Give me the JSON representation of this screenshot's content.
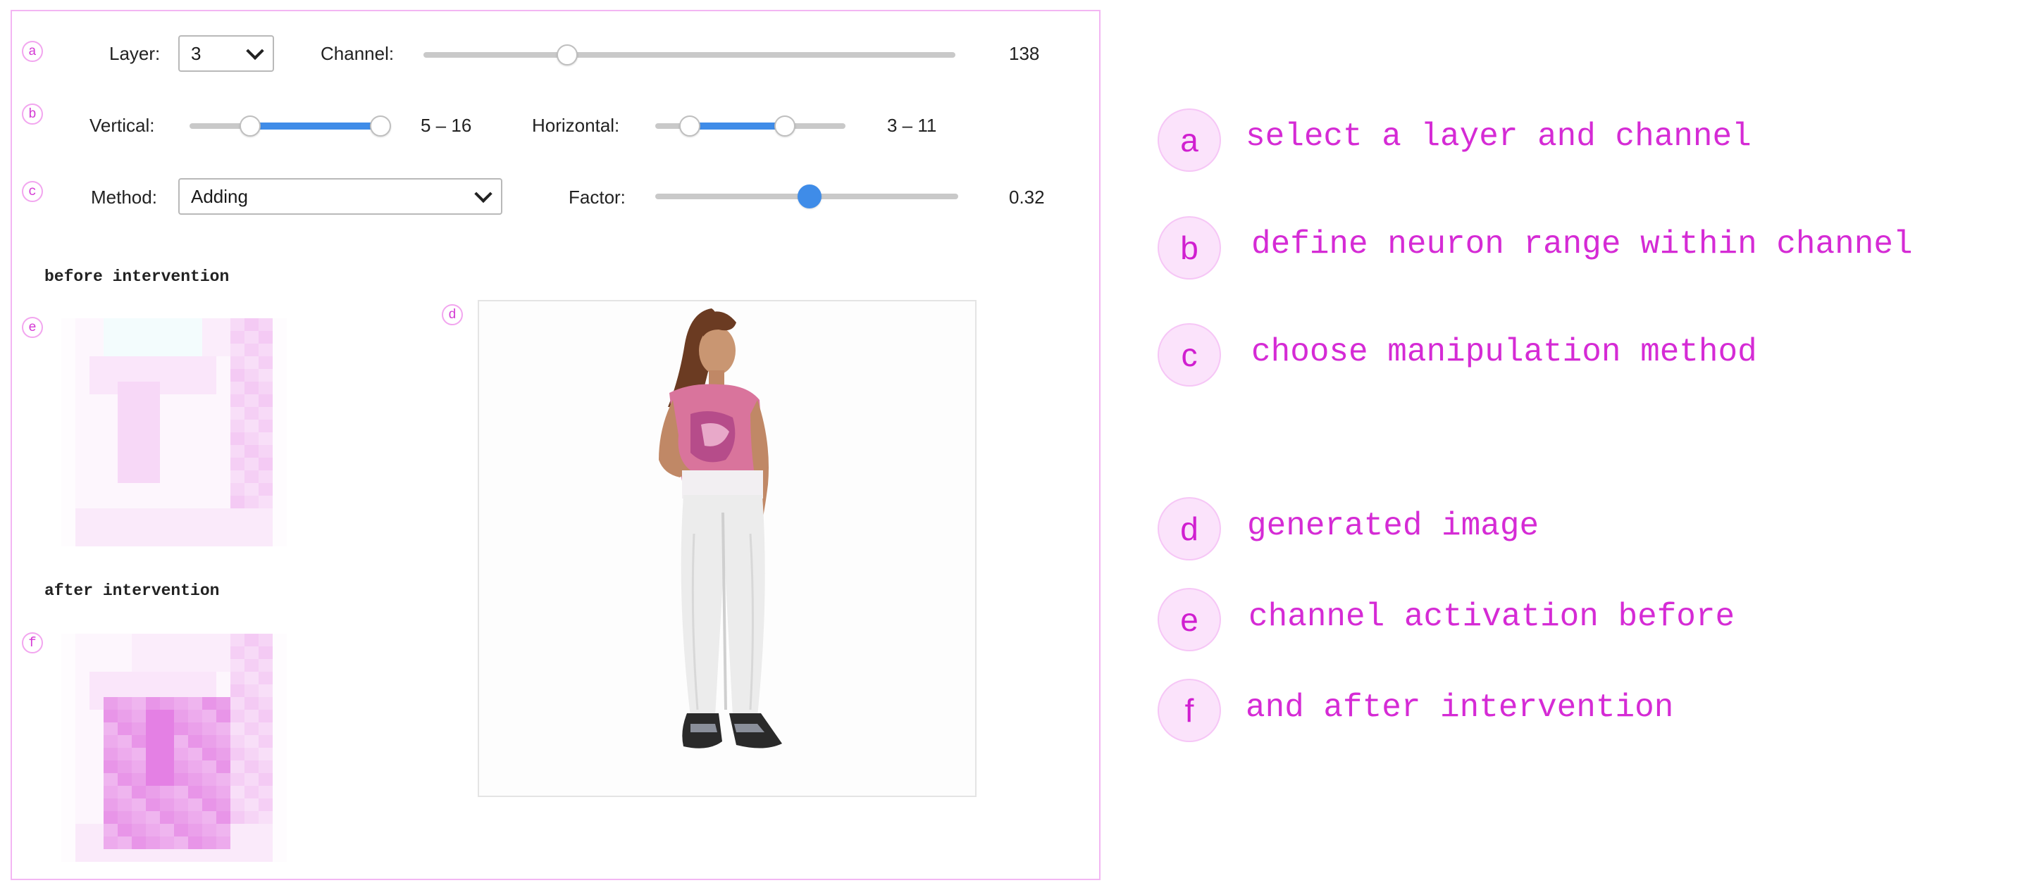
{
  "controls": {
    "layer_label": "Layer:",
    "layer_value": "3",
    "channel_label": "Channel:",
    "channel_value": "138",
    "channel_fraction": 0.27,
    "vertical_label": "Vertical:",
    "vertical_value": "5 – 16",
    "vertical_range": [
      0.3,
      0.95
    ],
    "horizontal_label": "Horizontal:",
    "horizontal_value": "3 – 11",
    "horizontal_range": [
      0.18,
      0.68
    ],
    "method_label": "Method:",
    "method_value": "Adding",
    "factor_label": "Factor:",
    "factor_value": "0.32",
    "factor_fraction": 0.51
  },
  "markers": {
    "a": "a",
    "b": "b",
    "c": "c",
    "d": "d",
    "e": "e",
    "f": "f"
  },
  "headings": {
    "before": "before intervention",
    "after": "after intervention"
  },
  "legend": [
    {
      "letter": "a",
      "text": "select a layer and channel"
    },
    {
      "letter": "b",
      "text": "define neuron range within channel"
    },
    {
      "letter": "c",
      "text": "choose manipulation method"
    },
    {
      "letter": "d",
      "text": "generated image"
    },
    {
      "letter": "e",
      "text": "channel activation before"
    },
    {
      "letter": "f",
      "text": "and after intervention"
    }
  ],
  "colors": {
    "accent": "#3f8ce8",
    "legend": "#d52bd5",
    "activation": "#d94fd9"
  }
}
